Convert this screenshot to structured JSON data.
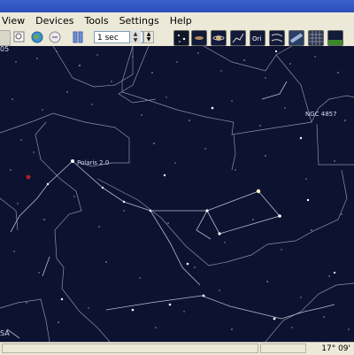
{
  "menubar": {
    "items": [
      "View",
      "Devices",
      "Tools",
      "Settings",
      "Help"
    ]
  },
  "toolbar": {
    "time_step_value": "1 sec"
  },
  "skymap": {
    "top_left_label": "05",
    "bottom_left_label": "SA",
    "labels": {
      "polaris": "Polaris 2.0",
      "ngc": "NGC 4857"
    }
  },
  "statusbar": {
    "coordinates": "17° 09'"
  },
  "colors": {
    "sky": "#0c1230",
    "constellation_lines": "#8d93a8",
    "chrome": "#ece9d8",
    "title_bar": "#2a4fb8"
  }
}
